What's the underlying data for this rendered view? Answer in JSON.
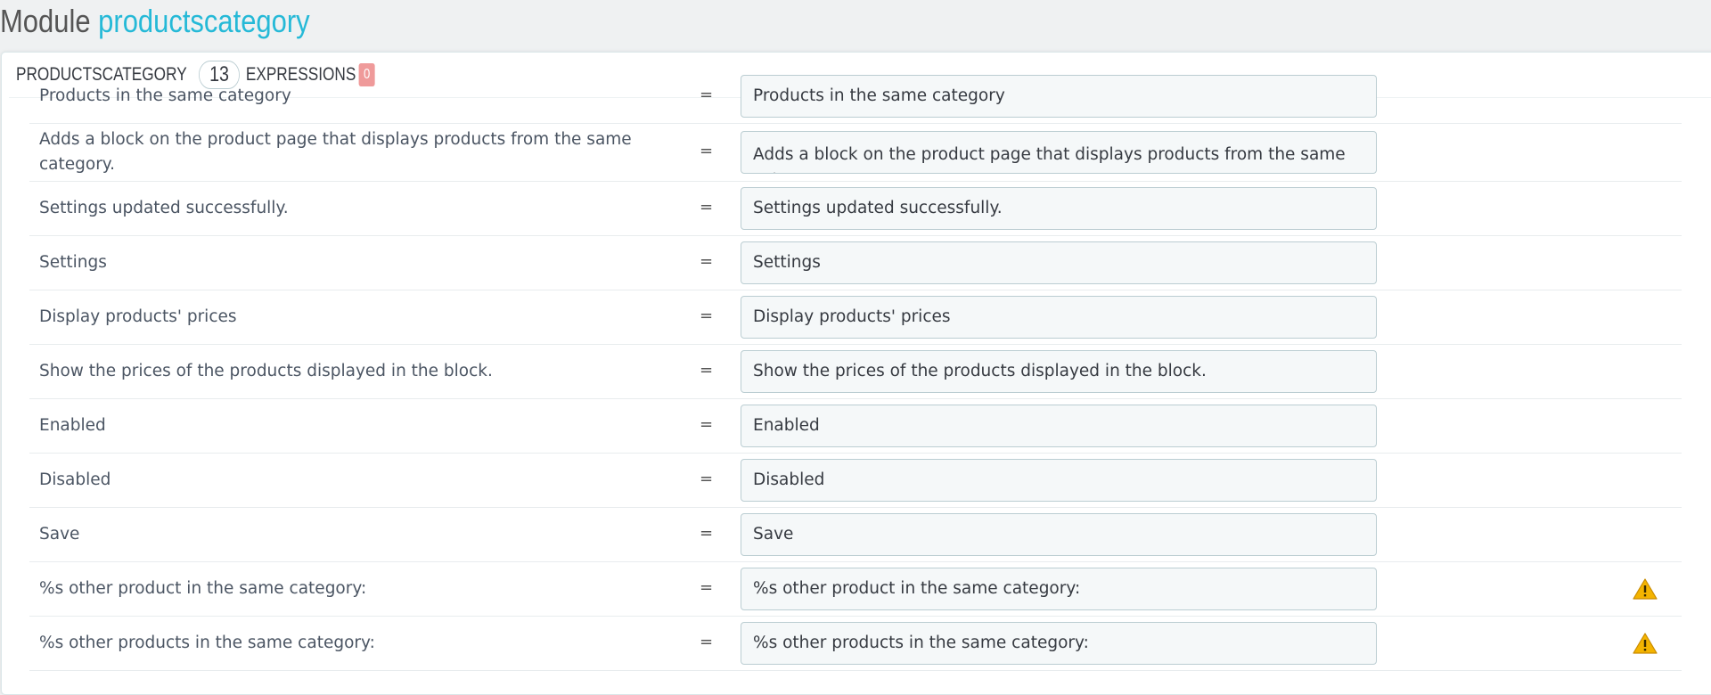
{
  "title": {
    "prefix": "Module",
    "module": "productscategory"
  },
  "heading": {
    "name": "PRODUCTSCATEGORY",
    "count": "13",
    "expressions_label": "EXPRESSIONS",
    "expressions_count": "0"
  },
  "rows": [
    {
      "source": "Products in the same category",
      "value": "Products in the same category",
      "warning": false
    },
    {
      "source": "Adds a block on the product page that displays products from the same category.",
      "value": "Adds a block on the product page that displays products from the same category.",
      "warning": false
    },
    {
      "source": "Settings updated successfully.",
      "value": "Settings updated successfully.",
      "warning": false
    },
    {
      "source": "Settings",
      "value": "Settings",
      "warning": false
    },
    {
      "source": "Display products' prices",
      "value": "Display products' prices",
      "warning": false
    },
    {
      "source": "Show the prices of the products displayed in the block.",
      "value": "Show the prices of the products displayed in the block.",
      "warning": false
    },
    {
      "source": "Enabled",
      "value": "Enabled",
      "warning": false
    },
    {
      "source": "Disabled",
      "value": "Disabled",
      "warning": false
    },
    {
      "source": "Save",
      "value": "Save",
      "warning": false
    },
    {
      "source": "%s other product in the same category:",
      "value": "%s other product in the same category:",
      "warning": true
    },
    {
      "source": "%s other products in the same category:",
      "value": "%s other products in the same category:",
      "warning": true
    }
  ],
  "equals_sign": "=",
  "colors": {
    "accent": "#25b9d7",
    "badge_danger": "#ef9a9a",
    "warning": "#f4b400"
  },
  "icons": {
    "warning": "warning-triangle-icon"
  }
}
